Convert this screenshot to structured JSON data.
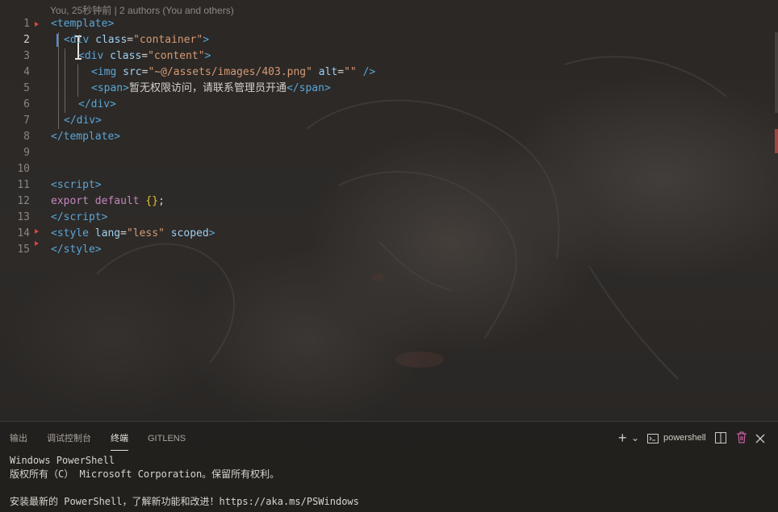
{
  "editor": {
    "blame": "You, 25秒钟前 | 2 authors (You and others)",
    "line_numbers": [
      "1",
      "2",
      "3",
      "4",
      "5",
      "6",
      "7",
      "8",
      "9",
      "10",
      "11",
      "12",
      "13",
      "14",
      "15"
    ],
    "code": {
      "l1": {
        "open": "<",
        "tag": "template",
        "close": ">"
      },
      "l2": {
        "open": "<",
        "tag": "div",
        "attr": " class",
        "eq": "=",
        "val": "\"container\"",
        "close": ">"
      },
      "l3": {
        "open": "<",
        "tag": "div",
        "attr": " class",
        "eq": "=",
        "val": "\"content\"",
        "close": ">"
      },
      "l4": {
        "open": "<",
        "tag": "img",
        "attr1": " src",
        "eq1": "=",
        "val1": "\"~@/assets/images/403.png\"",
        "attr2": " alt",
        "eq2": "=",
        "val2": "\"\"",
        "close": " />"
      },
      "l5": {
        "open": "<",
        "tag": "span",
        "mid": ">",
        "text": "暂无权限访问，请联系管理员开通",
        "end_open": "</",
        "end_tag": "span",
        "close": ">"
      },
      "l6": {
        "open": "</",
        "tag": "div",
        "close": ">"
      },
      "l7": {
        "open": "</",
        "tag": "div",
        "close": ">"
      },
      "l8": {
        "open": "</",
        "tag": "template",
        "close": ">"
      },
      "l11": {
        "open": "<",
        "tag": "script",
        "close": ">"
      },
      "l12": {
        "kw1": "export",
        "kw2": " default",
        "sp": " ",
        "brace": "{}",
        "semi": ";"
      },
      "l13": {
        "open": "</",
        "tag": "script",
        "close": ">"
      },
      "l14": {
        "open": "<",
        "tag": "style",
        "attr1": " lang",
        "eq": "=",
        "val": "\"less\"",
        "attr2": " scoped",
        "close": ">"
      },
      "l15": {
        "open": "</",
        "tag": "style",
        "close": ">"
      }
    }
  },
  "panel": {
    "tabs": [
      "输出",
      "调试控制台",
      "终端",
      "GITLENS"
    ],
    "active_tab": "终端",
    "toolbar": {
      "add_label": "+",
      "dropdown_label": "⌄",
      "shell_label": "powershell"
    },
    "terminal_lines": [
      "Windows PowerShell",
      "版权所有（C） Microsoft Corporation。保留所有权利。",
      "",
      "安装最新的 PowerShell，了解新功能和改进！https://aka.ms/PSWindows"
    ]
  },
  "colors": {
    "accent": "#4a90e2",
    "diff_marker": "#e0453b",
    "tag": "#5aa6d6",
    "string": "#d69a72",
    "keyword": "#c586c0"
  },
  "icons": [
    "terminal-icon",
    "split-icon",
    "trash-icon",
    "close-icon",
    "plus-icon",
    "chevron-down-icon"
  ]
}
